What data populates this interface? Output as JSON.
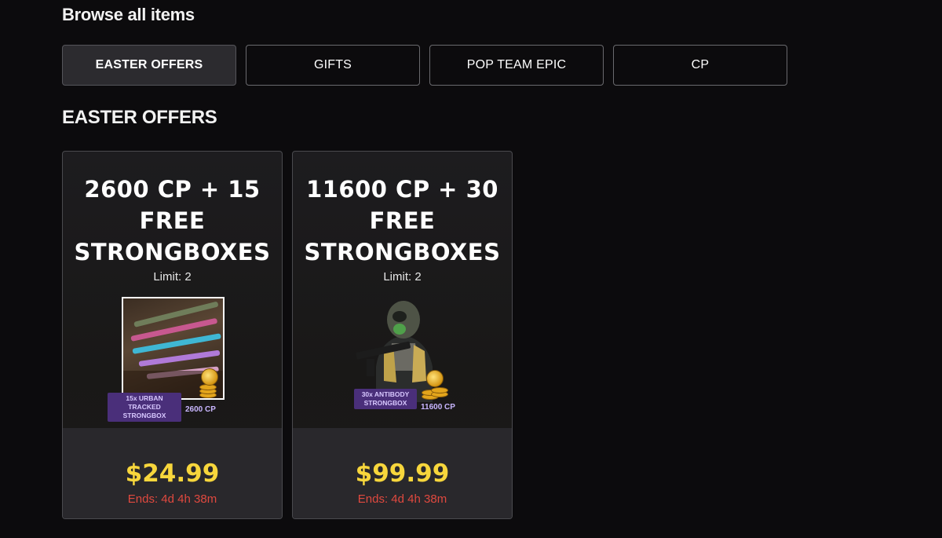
{
  "page": {
    "heading": "Browse all items",
    "section_title": "EASTER OFFERS"
  },
  "tabs": [
    {
      "label": "EASTER OFFERS",
      "active": true
    },
    {
      "label": "GIFTS",
      "active": false
    },
    {
      "label": "POP TEAM EPIC",
      "active": false
    },
    {
      "label": "CP",
      "active": false
    }
  ],
  "offers": [
    {
      "title_line1": "2600 CP + 15",
      "title_line2": "FREE",
      "title_line3": "STRONGBOXES",
      "limit": "Limit: 2",
      "art_tag": "15x URBAN TRACKED STRONGBOX",
      "art_cp": "2600 CP",
      "price": "$24.99",
      "ends": "Ends: 4d 4h 38m"
    },
    {
      "title_line1": "11600 CP + 30",
      "title_line2": "FREE",
      "title_line3": "STRONGBOXES",
      "limit": "Limit: 2",
      "art_tag": "30x ANTIBODY STRONGBOX",
      "art_cp": "11600 CP",
      "price": "$99.99",
      "ends": "Ends: 4d 4h 38m"
    }
  ],
  "colors": {
    "background": "#0c0b0d",
    "price": "#f7d63c",
    "timer": "#e0493f",
    "tag": "#4a2f7a",
    "active_tab": "#2c2b2f"
  },
  "icons": [
    "cp-coin-icon",
    "weapon-bundle-image",
    "operator-image"
  ]
}
